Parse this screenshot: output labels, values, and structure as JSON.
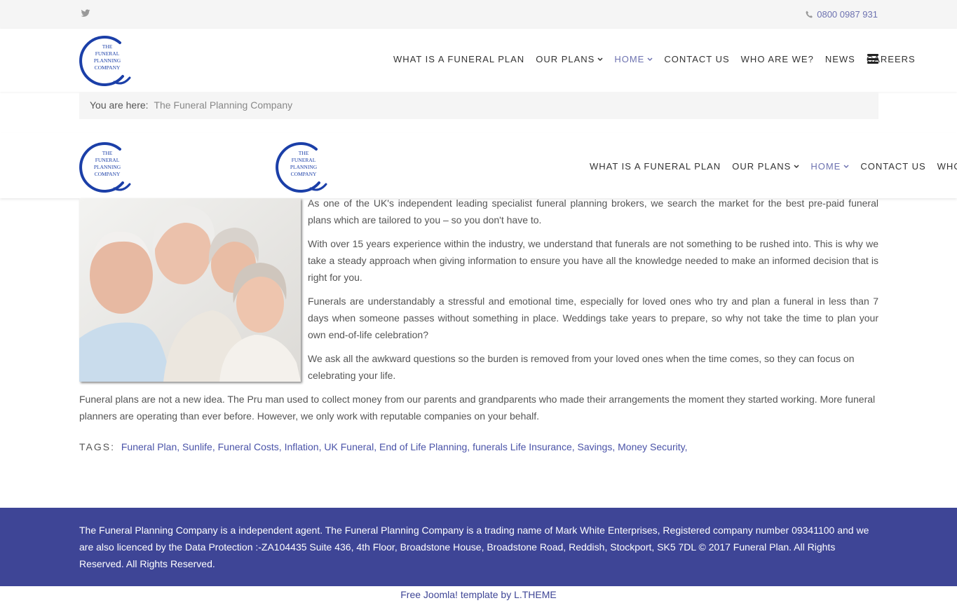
{
  "topbar": {
    "twitter_icon": "twitter-icon",
    "phone_icon": "phone-icon",
    "phone": "0800 0987 931"
  },
  "logo": {
    "line1": "THE",
    "line2": "FUNERAL",
    "line3": "PLANNING",
    "line4": "COMPANY"
  },
  "nav": {
    "items": [
      {
        "label": "WHAT IS A FUNERAL PLAN"
      },
      {
        "label": "OUR PLANS"
      },
      {
        "label": "HOME"
      },
      {
        "label": "CONTACT US"
      },
      {
        "label": "WHO ARE WE?"
      },
      {
        "label": "NEWS"
      },
      {
        "label": "CAREERS"
      }
    ],
    "sticky_last_label": "WHO ARE WE",
    "menu_icon": "hamburger-icon"
  },
  "breadcrumb": {
    "prefix": "You are here:",
    "current": "The Funeral Planning Company"
  },
  "content": {
    "image": "elderly-group-photo",
    "p1": "As one of the UK's independent leading specialist funeral planning brokers, we search the market for the best pre-paid funeral plans which are tailored to you – so you don't have to.",
    "p2": "With over 15 years experience within the industry, we understand that funerals are not something to be rushed into. This is why we take a steady approach when giving information to ensure you have all the knowledge needed to make an informed decision that is right for you.",
    "p3": "Funerals are understandably a stressful and emotional time, especially for loved ones who try and plan a funeral in less than 7 days when someone passes without something in place. Weddings take years to prepare, so why not take the time to plan your own end-of-life celebration?",
    "p4": "We ask all the awkward questions so the burden is removed from your loved ones when the time comes, so they can focus on celebrating your life.",
    "p5": "Funeral plans are not a new idea. The Pru man used to collect money from our parents and grandparents who made their arrangements the moment they started working. More funeral planners are operating than ever before. However, we only work with reputable companies on your behalf."
  },
  "tags": {
    "label": "TAGS:",
    "items": [
      "Funeral Plan,",
      "Sunlife,",
      "Funeral Costs,",
      "Inflation,",
      "UK Funeral,",
      "End of Life Planning,",
      "funerals",
      "Life Insurance,",
      "Savings,",
      "Money Security,"
    ]
  },
  "footer": {
    "text": "The Funeral Planning Company is a independent agent. The Funeral Planning Company is a trading name of Mark White Enterprises, Registered company number 09341100 and we are also licenced by the Data Protection :-ZA104435 Suite 436, 4th Floor, Broadstone House, Broadstone Road, Reddish, Stockport, SK5 7DL © 2017 Funeral Plan. All Rights Reserved. All Rights Reserved.",
    "credit": "Free Joomla! template by L.THEME"
  },
  "colors": {
    "brand": "#3e4596",
    "link": "#4a53a8",
    "active_nav": "#6d72b0"
  }
}
